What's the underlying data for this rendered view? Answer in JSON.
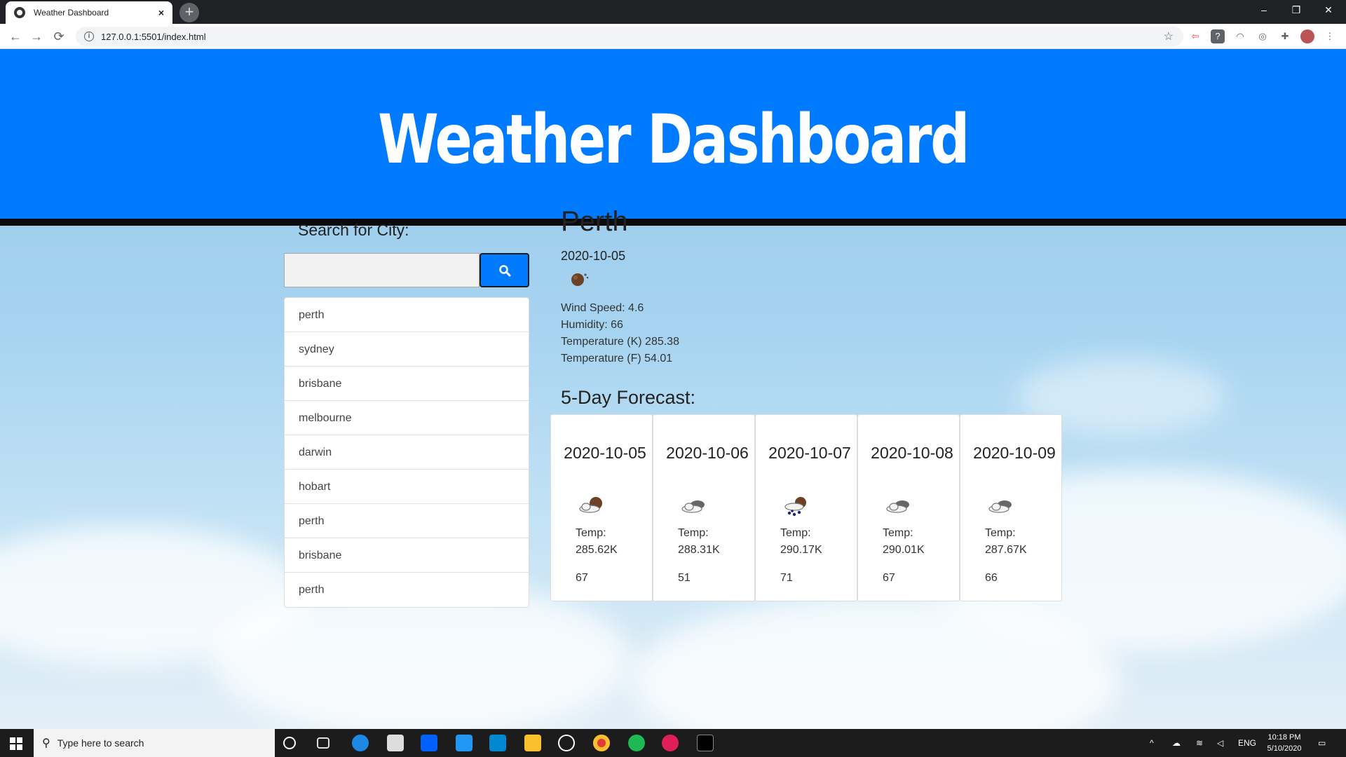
{
  "browser": {
    "tab_title": "Weather Dashboard",
    "tab_close": "×",
    "new_tab": "+",
    "url": "127.0.0.1:5501/index.html",
    "window_controls": [
      "–",
      "❐",
      "✕"
    ]
  },
  "header": {
    "title": "Weather Dashboard"
  },
  "search": {
    "label": "Search for City:",
    "input_value": "",
    "history": [
      "perth",
      "sydney",
      "brisbane",
      "melbourne",
      "darwin",
      "hobart",
      "perth",
      "brisbane",
      "perth"
    ]
  },
  "current": {
    "city": "Perth",
    "date": "2020-10-05",
    "icon": "rain-night-icon",
    "wind": "Wind Speed: 4.6",
    "humidity": "Humidity: 66",
    "temp_k": "Temperature (K) 285.38",
    "temp_f": "Temperature (F) 54.01"
  },
  "forecast": {
    "title": "5-Day Forecast:",
    "days": [
      {
        "date": "2020-10-05",
        "icon": "cloud-moon-icon",
        "temp_label": "Temp:",
        "temp": "285.62K",
        "humidity": "67"
      },
      {
        "date": "2020-10-06",
        "icon": "cloud-icon",
        "temp_label": "Temp:",
        "temp": "288.31K",
        "humidity": "51"
      },
      {
        "date": "2020-10-07",
        "icon": "rain-cloud-icon",
        "temp_label": "Temp:",
        "temp": "290.17K",
        "humidity": "71"
      },
      {
        "date": "2020-10-08",
        "icon": "cloud-icon",
        "temp_label": "Temp:",
        "temp": "290.01K",
        "humidity": "67"
      },
      {
        "date": "2020-10-09",
        "icon": "cloud-icon",
        "temp_label": "Temp:",
        "temp": "287.67K",
        "humidity": "66"
      }
    ]
  },
  "taskbar": {
    "search_placeholder": "Type here to search",
    "lang": "ENG",
    "time": "10:18 PM",
    "date": "5/10/2020"
  },
  "colors": {
    "accent": "#007bff",
    "header_border": "#0a0a0a"
  }
}
